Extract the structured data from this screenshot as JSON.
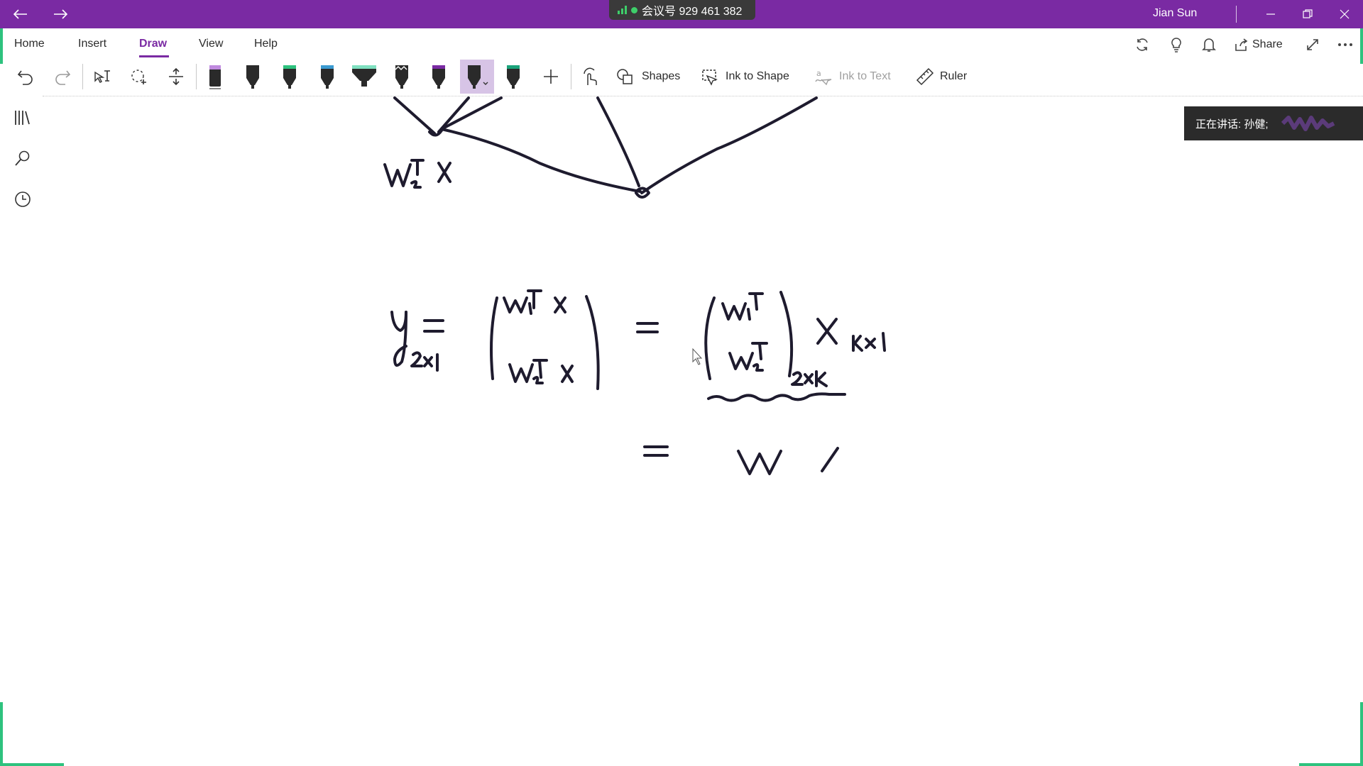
{
  "titlebar": {
    "meeting_label": "会议号 929 461 382",
    "user": "Jian Sun",
    "back_icon": "back-arrow-icon",
    "forward_icon": "forward-arrow-icon",
    "accent": "#7a2aa3"
  },
  "tabs": [
    {
      "label": "Home"
    },
    {
      "label": "Insert"
    },
    {
      "label": "Draw"
    },
    {
      "label": "View"
    },
    {
      "label": "Help"
    }
  ],
  "share_label": "Share",
  "toolbar": {
    "shapes": "Shapes",
    "ink_to_shape": "Ink to Shape",
    "ink_to_text": "Ink to Text",
    "ruler": "Ruler"
  },
  "toast": {
    "text": "正在讲话: 孙健;"
  },
  "pens": [
    {
      "color": "#2a2a2a",
      "tip": "#c08adf"
    },
    {
      "color": "#2a2a2a",
      "tip": "#2a2a2a"
    },
    {
      "color": "#2a2a2a",
      "tip": "#2ec27e"
    },
    {
      "color": "#2a2a2a",
      "tip": "#3b9ad1"
    },
    {
      "color": "#2a2a2a",
      "tip": "#7fe0c0"
    },
    {
      "color": "#2a2a2a",
      "tip": "#2a2a2a"
    },
    {
      "color": "#2a2a2a",
      "tip": "#7a2aa3"
    },
    {
      "color": "#2a2a2a",
      "tip": "#2a2a2a"
    },
    {
      "color": "#2a2a2a",
      "tip": "#1aa37a"
    }
  ]
}
